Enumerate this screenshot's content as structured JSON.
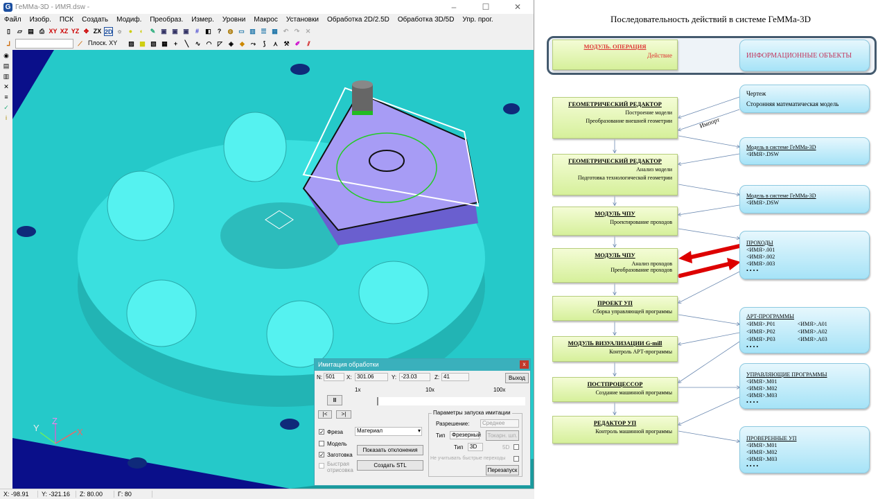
{
  "app": {
    "title": "ГеММа-3D - ИМЯ.dsw -",
    "menu": [
      "Файл",
      "Изобр.",
      "ПСК",
      "Создать",
      "Модиф.",
      "Преобраз.",
      "Измер.",
      "Уровни",
      "Макрос",
      "Установки",
      "Обработка 2D/2.5D",
      "Обработка 3D/5D",
      "Упр. прог."
    ],
    "toolbar_xy": "XY",
    "toolbar_xz": "XZ",
    "toolbar_yz": "YZ",
    "toolbar_zx": "ZX",
    "toolbar_2d": "2D",
    "plane_select": "Плоск. XY",
    "status": {
      "x": "X: -98.91",
      "y": "Y: -321.16",
      "z": "Z: 80.00",
      "g": "Г: 80"
    },
    "axes": {
      "x": "X",
      "y": "Y",
      "z": "Z"
    }
  },
  "dialog": {
    "title": "Имитация обработки",
    "n_label": "N:",
    "n": "501",
    "x_label": "X:",
    "x": "301.06",
    "y_label": "Y:",
    "y": "-23.03",
    "z_label": "Z:",
    "z": "41",
    "exit": "Выход",
    "speed_1x": "1x",
    "speed_10x": "10x",
    "speed_100x": "100x",
    "pause": "II",
    "prev": "|<",
    "next": ">|",
    "cutter": "Фреза",
    "model": "Модель",
    "stock": "Заготовка",
    "fast_draw": "Быстрая отрисовка",
    "material": "Материал",
    "show_dev": "Показать отклонения",
    "create_stl": "Создать STL",
    "params_title": "Параметры запуска имитации",
    "resolution_label": "Разрешение:",
    "resolution": "Среднее",
    "type_label": "Тип",
    "type_value": "Фрезерный",
    "lathe": "Токарн. шп.",
    "type2_label": "Тип",
    "type2_value": "3D",
    "fived": "5D",
    "ignore_rapid": "Не учитывать быстрые переходы",
    "restart": "Перезапуск",
    "checks": {
      "cutter": true,
      "model": false,
      "stock": true,
      "fast_draw": false
    }
  },
  "diagram": {
    "title": "Последовательность действий в системе ГеММа-3D",
    "legend": {
      "module": "МОДУЛЬ. ОПЕРАЦИЯ",
      "action": "Действие",
      "info": "ИНФОРМАЦИОННЫЕ ОБЪЕКТЫ"
    },
    "import_label": "Импорт",
    "modules": [
      {
        "title": "ГЕОМЕТРИЧЕСКИЙ  РЕДАКТОР",
        "actions": [
          "Построение модели",
          "Преобразование внешней геометрии"
        ]
      },
      {
        "title": "ГЕОМЕТРИЧЕСКИЙ  РЕДАКТОР",
        "actions": [
          "Анализ модели",
          "Подготовка технологической геометрии"
        ]
      },
      {
        "title": "МОДУЛЬ ЧПУ",
        "actions": [
          "Проектирование проходов"
        ]
      },
      {
        "title": "МОДУЛЬ ЧПУ",
        "actions": [
          "Анализ проходов",
          "Преобразование проходов"
        ]
      },
      {
        "title": "ПРОЕКТ  УП",
        "actions": [
          "Сборка управляющей программы"
        ]
      },
      {
        "title": "МОДУЛЬ ВИЗУАЛИЗАЦИИ  G-mill",
        "actions": [
          "Контроль АРТ-программы"
        ]
      },
      {
        "title": "ПОСТПРОЦЕССОР",
        "actions": [
          "Создание машинной программы"
        ]
      },
      {
        "title": "РЕДАКТОР  УП",
        "actions": [
          "Контроль машинной программы"
        ]
      }
    ],
    "objects": [
      {
        "lines": [
          "Чертеж",
          "Сторонняя математическая модель"
        ]
      },
      {
        "title": "Модель в системе ГеММа-3D",
        "lines": [
          "<ИМЯ>.DSW"
        ]
      },
      {
        "title": "Модель в системе ГеММа-3D",
        "lines": [
          "<ИМЯ>.DSW"
        ]
      },
      {
        "title": "ПРОХОДЫ",
        "lines": [
          "<ИМЯ>.001",
          "<ИМЯ>.002",
          "<ИМЯ>.003",
          "• • • •"
        ]
      },
      {
        "title": "АРТ-ПРОГРАММЫ",
        "lines": [
          "<ИМЯ>.P01        <ИМЯ>.A01",
          "<ИМЯ>.P02        <ИМЯ>.A02",
          "<ИМЯ>.P03        <ИМЯ>.A03",
          "• • • •"
        ]
      },
      {
        "title": "УПРАВЛЯЮЩИЕ  ПРОГРАММЫ",
        "lines": [
          "<ИМЯ>.M01",
          "<ИМЯ>.M02",
          "<ИМЯ>.M03",
          "• • • •"
        ]
      },
      {
        "title": "ПРОВЕРЕННЫЕ  УП",
        "lines": [
          "<ИМЯ>.M01",
          "<ИМЯ>.M02",
          "<ИМЯ>.M03",
          "• • • •"
        ]
      }
    ]
  }
}
